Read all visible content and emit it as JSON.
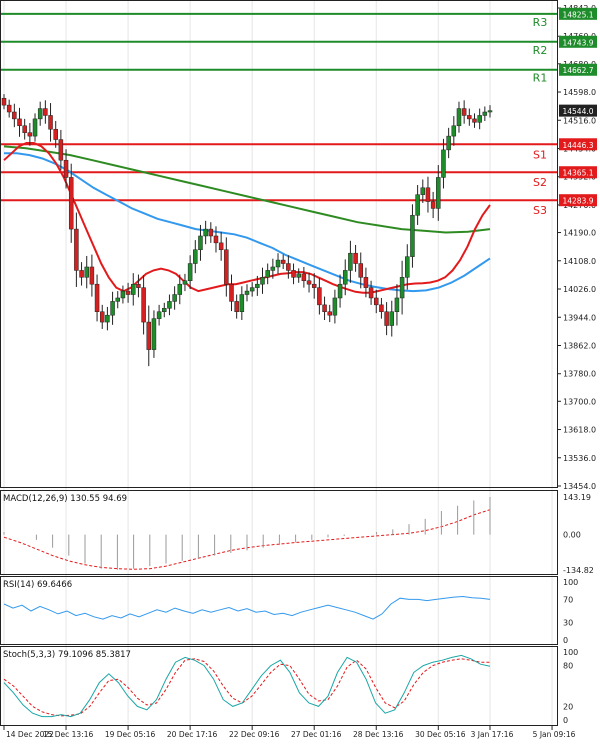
{
  "colors": {
    "bull": "#1e8c2a",
    "bear": "#d42020",
    "ma_fast": "#e31a1c",
    "ma_mid": "#3399ee",
    "ma_slow": "#2e8b22",
    "level_res": "#1e8c2a",
    "level_sup": "#e31a1c",
    "macd_line": "#e31a1c",
    "macd_hist": "#9a9a9a",
    "rsi_line": "#3399ee",
    "stoch_k": "#1aa6a6",
    "stoch_d": "#e31a1c"
  },
  "chart_data": [
    {
      "type": "candlestick",
      "panel": "price",
      "ylim": [
        13454,
        14842
      ],
      "y_ticks": [
        "14842.0",
        "14760.0",
        "14680.0",
        "14598.0",
        "14516.0",
        "14434.0",
        "14352.0",
        "14270.0",
        "14190.0",
        "14108.0",
        "14026.0",
        "13944.0",
        "13862.0",
        "13780.0",
        "13700.0",
        "13618.0",
        "13536.0",
        "13454.0"
      ],
      "x_ticks": [
        "14 Dec 2022",
        "15 Dec 13:16",
        "19 Dec 05:16",
        "20 Dec 17:16",
        "22 Dec 09:16",
        "27 Dec 01:16",
        "28 Dec 13:16",
        "30 Dec 05:16",
        "3 Jan 17:16",
        "5 Jan 09:16"
      ],
      "x_tick_index": [
        0,
        12,
        24,
        36,
        48,
        60,
        72,
        84,
        94,
        106
      ],
      "current_price_label": "14544.0",
      "current_price": 14544,
      "levels": [
        {
          "name": "R3",
          "value": 14825.1,
          "label": "14825.1",
          "kind": "resistance"
        },
        {
          "name": "R2",
          "value": 14743.9,
          "label": "14743.9",
          "kind": "resistance"
        },
        {
          "name": "R1",
          "value": 14662.7,
          "label": "14662.7",
          "kind": "resistance"
        },
        {
          "name": "S1",
          "value": 14446.3,
          "label": "14446.3",
          "kind": "support"
        },
        {
          "name": "S2",
          "value": 14365.1,
          "label": "14365.1",
          "kind": "support"
        },
        {
          "name": "S3",
          "value": 14283.9,
          "label": "14283.9",
          "kind": "support"
        }
      ],
      "close": [
        14560,
        14540,
        14520,
        14500,
        14480,
        14470,
        14520,
        14550,
        14530,
        14490,
        14460,
        14400,
        14350,
        14200,
        14080,
        14060,
        14090,
        14040,
        13960,
        13930,
        13950,
        13990,
        14000,
        14020,
        14010,
        14040,
        14030,
        13930,
        13850,
        13940,
        13960,
        13970,
        13990,
        14010,
        14040,
        14050,
        14100,
        14140,
        14180,
        14200,
        14180,
        14160,
        14140,
        14040,
        13990,
        13960,
        14010,
        14020,
        14030,
        14040,
        14060,
        14080,
        14090,
        14110,
        14100,
        14080,
        14060,
        14070,
        14050,
        14040,
        14030,
        13980,
        13960,
        13950,
        14000,
        14040,
        14080,
        14130,
        14100,
        14060,
        14030,
        14000,
        13980,
        13960,
        13920,
        13960,
        14000,
        14060,
        14120,
        14240,
        14300,
        14320,
        14280,
        14260,
        14350,
        14430,
        14470,
        14500,
        14550,
        14530,
        14520,
        14510,
        14530,
        14540,
        14544
      ],
      "ma_fast": [
        14400,
        14420,
        14440,
        14450,
        14450,
        14440,
        14420,
        14390,
        14350,
        14300,
        14250,
        14200,
        14150,
        14100,
        14060,
        14030,
        14020,
        14030,
        14050,
        14070,
        14080,
        14085,
        14080,
        14070,
        14050,
        14030,
        14020,
        14025,
        14030,
        14035,
        14040,
        14040,
        14045,
        14050,
        14055,
        14060,
        14065,
        14070,
        14072,
        14075,
        14075,
        14070,
        14060,
        14050,
        14040,
        14032,
        14025,
        14018,
        14015,
        14015,
        14020,
        14025,
        14030,
        14035,
        14040,
        14042,
        14043,
        14045,
        14050,
        14060,
        14080,
        14110,
        14150,
        14200,
        14240,
        14270
      ],
      "ma_mid": [
        14420,
        14420,
        14415,
        14405,
        14390,
        14370,
        14345,
        14320,
        14300,
        14280,
        14260,
        14245,
        14230,
        14220,
        14210,
        14200,
        14195,
        14190,
        14185,
        14175,
        14160,
        14145,
        14125,
        14110,
        14095,
        14080,
        14065,
        14050,
        14040,
        14032,
        14026,
        14022,
        14020,
        14022,
        14030,
        14045,
        14065,
        14090,
        14115
      ],
      "ma_slow": [
        14440,
        14435,
        14425,
        14415,
        14400,
        14385,
        14370,
        14355,
        14340,
        14325,
        14310,
        14295,
        14280,
        14265,
        14250,
        14235,
        14220,
        14210,
        14200,
        14195,
        14190,
        14192,
        14200
      ],
      "hl_spread": [
        30,
        40,
        60,
        80,
        50,
        70,
        40,
        50,
        60,
        90,
        60,
        70,
        80,
        100,
        120,
        60,
        80,
        90,
        70,
        50,
        60,
        70,
        50,
        40,
        60,
        80,
        70,
        90,
        120,
        60,
        50,
        40,
        50,
        60,
        70,
        50,
        60,
        70,
        80,
        60,
        50,
        70,
        80,
        90,
        70,
        50,
        60,
        50,
        40,
        60,
        70,
        50,
        60,
        50,
        40,
        60,
        50,
        40,
        50,
        60,
        80,
        70,
        60,
        50,
        60,
        70,
        80,
        90,
        60,
        80,
        70,
        50,
        60,
        50,
        70,
        80,
        100,
        120,
        90,
        80,
        70,
        60,
        80,
        70,
        90,
        80,
        60,
        70,
        50,
        60,
        50,
        40,
        50,
        40,
        40
      ]
    },
    {
      "type": "macd",
      "panel": "macd",
      "title": "MACD(12,26,9) 130.55 94.69",
      "y_ticks": [
        "143.19",
        "0.00",
        "-134.82"
      ],
      "ylim": [
        -134.82,
        143.19
      ],
      "signal": [
        -10,
        -30,
        -55,
        -80,
        -100,
        -115,
        -125,
        -130,
        -132,
        -130,
        -120,
        -105,
        -90,
        -75,
        -60,
        -50,
        -42,
        -36,
        -30,
        -25,
        -20,
        -15,
        -10,
        -5,
        0,
        5,
        15,
        30,
        50,
        75,
        95
      ],
      "hist": [
        10,
        0,
        -20,
        -50,
        -80,
        -110,
        -130,
        -134,
        -130,
        -120,
        -110,
        -100,
        -90,
        -80,
        -70,
        -60,
        -50,
        -40,
        -30,
        -20,
        -10,
        -5,
        0,
        10,
        20,
        40,
        60,
        90,
        110,
        130,
        143
      ]
    },
    {
      "type": "line",
      "panel": "rsi",
      "title": "RSI(14) 69.6466",
      "y_ticks": [
        "100",
        "70",
        "30",
        "0"
      ],
      "ylim": [
        0,
        100
      ],
      "values": [
        62,
        55,
        60,
        50,
        58,
        52,
        45,
        50,
        42,
        46,
        40,
        36,
        42,
        38,
        45,
        40,
        46,
        52,
        48,
        55,
        50,
        46,
        52,
        48,
        52,
        56,
        50,
        54,
        48,
        50,
        44,
        46,
        42,
        48,
        52,
        56,
        60,
        56,
        52,
        48,
        42,
        36,
        45,
        62,
        72,
        70,
        70,
        68,
        70,
        72,
        74,
        75,
        73,
        72,
        70
      ]
    },
    {
      "type": "line",
      "panel": "stoch",
      "title": "Stoch(5,3,3) 79.1096 85.3817",
      "y_ticks": [
        "100",
        "80",
        "20",
        "0"
      ],
      "ylim": [
        0,
        100
      ],
      "k": [
        55,
        40,
        22,
        10,
        5,
        5,
        8,
        5,
        10,
        30,
        55,
        68,
        55,
        35,
        20,
        15,
        30,
        60,
        85,
        92,
        88,
        80,
        60,
        30,
        20,
        25,
        45,
        65,
        80,
        88,
        70,
        40,
        25,
        20,
        35,
        70,
        92,
        85,
        60,
        25,
        10,
        15,
        40,
        70,
        80,
        85,
        88,
        92,
        95,
        90,
        82,
        79
      ],
      "d": [
        60,
        50,
        35,
        20,
        12,
        8,
        6,
        7,
        9,
        20,
        40,
        58,
        60,
        48,
        32,
        22,
        25,
        45,
        70,
        88,
        90,
        86,
        72,
        50,
        32,
        25,
        35,
        52,
        70,
        82,
        80,
        60,
        38,
        28,
        30,
        50,
        78,
        88,
        75,
        48,
        25,
        18,
        28,
        52,
        70,
        80,
        85,
        88,
        90,
        88,
        85,
        85
      ]
    }
  ]
}
